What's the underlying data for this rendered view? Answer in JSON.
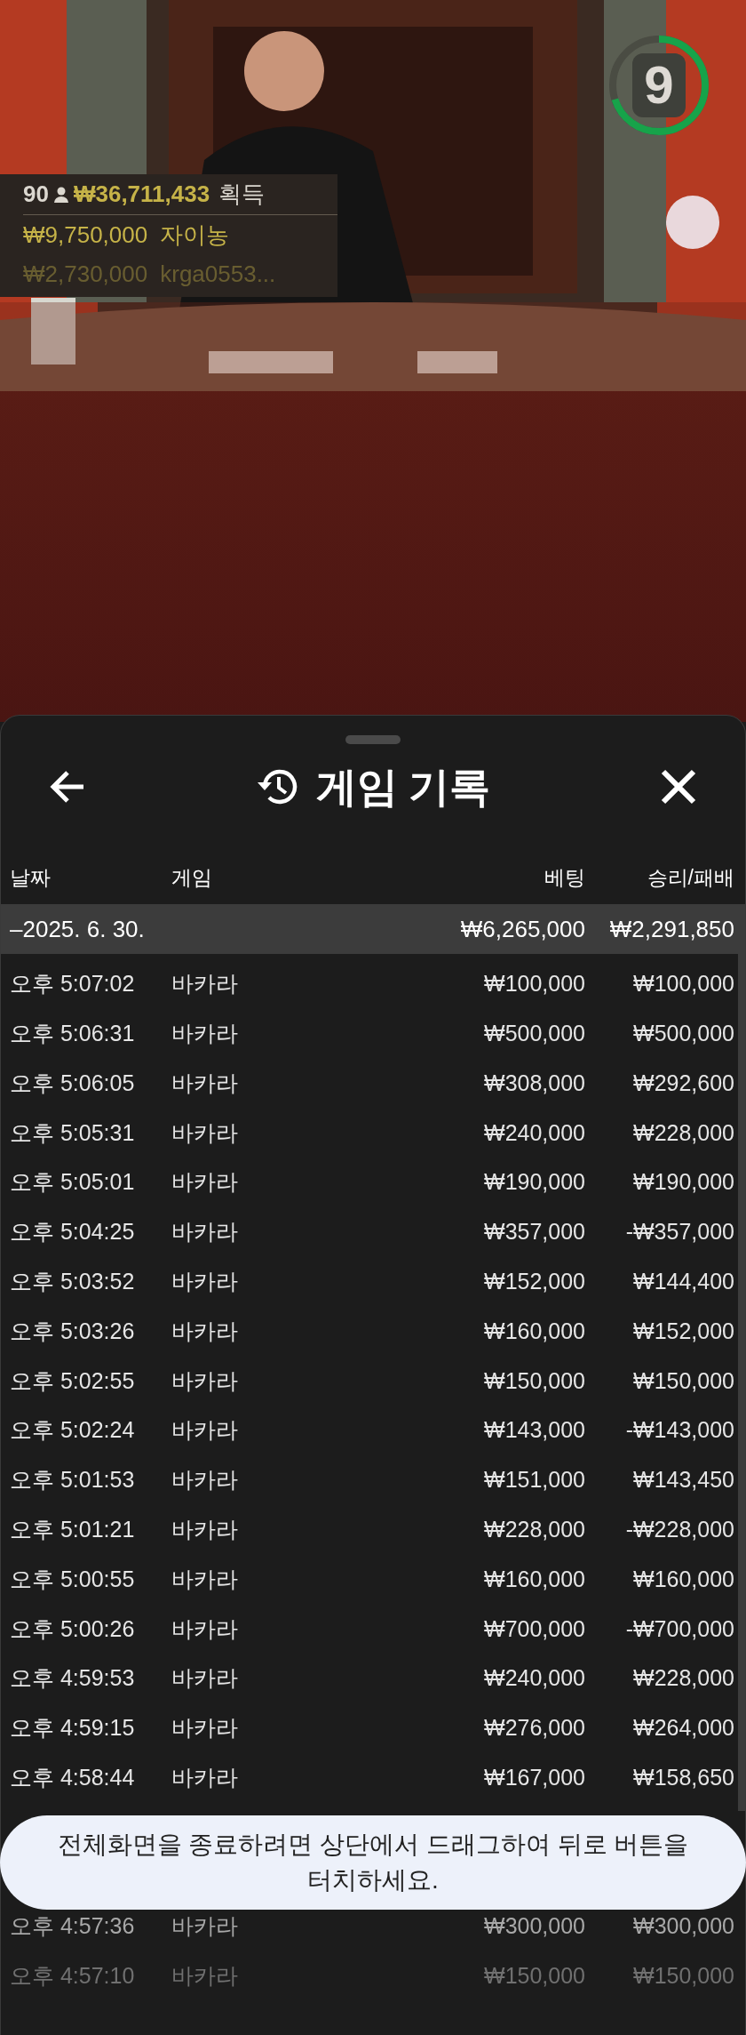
{
  "video": {
    "timer": {
      "value": "9",
      "level": 0.7
    },
    "winners": {
      "count": "90",
      "total": "₩36,711,433",
      "total_label": "획득",
      "entries": [
        {
          "amount": "₩9,750,000",
          "name": "자이농",
          "faded": false
        },
        {
          "amount": "₩2,730,000",
          "name": "krga0553...",
          "faded": true
        }
      ]
    }
  },
  "sheet": {
    "title": "게임 기록",
    "columns": [
      "날짜",
      "게임",
      "베팅",
      "승리/패배"
    ],
    "summary": {
      "date": "–2025. 6. 30.",
      "bet": "₩6,265,000",
      "result": "₩2,291,850"
    },
    "rows": [
      {
        "time": "오후 5:07:02",
        "game": "바카라",
        "bet": "₩100,000",
        "result": "₩100,000",
        "kind": "normal"
      },
      {
        "time": "오후 5:06:31",
        "game": "바카라",
        "bet": "₩500,000",
        "result": "₩500,000",
        "kind": "normal"
      },
      {
        "time": "오후 5:06:05",
        "game": "바카라",
        "bet": "₩308,000",
        "result": "₩292,600",
        "kind": "normal"
      },
      {
        "time": "오후 5:05:31",
        "game": "바카라",
        "bet": "₩240,000",
        "result": "₩228,000",
        "kind": "normal"
      },
      {
        "time": "오후 5:05:01",
        "game": "바카라",
        "bet": "₩190,000",
        "result": "₩190,000",
        "kind": "normal"
      },
      {
        "time": "오후 5:04:25",
        "game": "바카라",
        "bet": "₩357,000",
        "result": "-₩357,000",
        "kind": "normal"
      },
      {
        "time": "오후 5:03:52",
        "game": "바카라",
        "bet": "₩152,000",
        "result": "₩144,400",
        "kind": "normal"
      },
      {
        "time": "오후 5:03:26",
        "game": "바카라",
        "bet": "₩160,000",
        "result": "₩152,000",
        "kind": "normal"
      },
      {
        "time": "오후 5:02:55",
        "game": "바카라",
        "bet": "₩150,000",
        "result": "₩150,000",
        "kind": "normal"
      },
      {
        "time": "오후 5:02:24",
        "game": "바카라",
        "bet": "₩143,000",
        "result": "-₩143,000",
        "kind": "normal"
      },
      {
        "time": "오후 5:01:53",
        "game": "바카라",
        "bet": "₩151,000",
        "result": "₩143,450",
        "kind": "normal"
      },
      {
        "time": "오후 5:01:21",
        "game": "바카라",
        "bet": "₩228,000",
        "result": "-₩228,000",
        "kind": "normal"
      },
      {
        "time": "오후 5:00:55",
        "game": "바카라",
        "bet": "₩160,000",
        "result": "₩160,000",
        "kind": "normal"
      },
      {
        "time": "오후 5:00:26",
        "game": "바카라",
        "bet": "₩700,000",
        "result": "-₩700,000",
        "kind": "normal"
      },
      {
        "time": "오후 4:59:53",
        "game": "바카라",
        "bet": "₩240,000",
        "result": "₩228,000",
        "kind": "normal"
      },
      {
        "time": "오후 4:59:15",
        "game": "바카라",
        "bet": "₩276,000",
        "result": "₩264,000",
        "kind": "normal"
      },
      {
        "time": "오후 4:58:44",
        "game": "바카라",
        "bet": "₩167,000",
        "result": "₩158,650",
        "kind": "normal"
      },
      {
        "kind": "hidden"
      },
      {
        "kind": "hidden"
      },
      {
        "time": "오후 4:57:36",
        "game": "바카라",
        "bet": "₩300,000",
        "result": "₩300,000",
        "kind": "dim"
      },
      {
        "time": "오후 4:57:10",
        "game": "바카라",
        "bet": "₩150,000",
        "result": "₩150,000",
        "kind": "faint"
      }
    ]
  },
  "toast": "전체화면을 종료하려면 상단에서 드래그하여 뒤로 버튼을 터치하세요."
}
